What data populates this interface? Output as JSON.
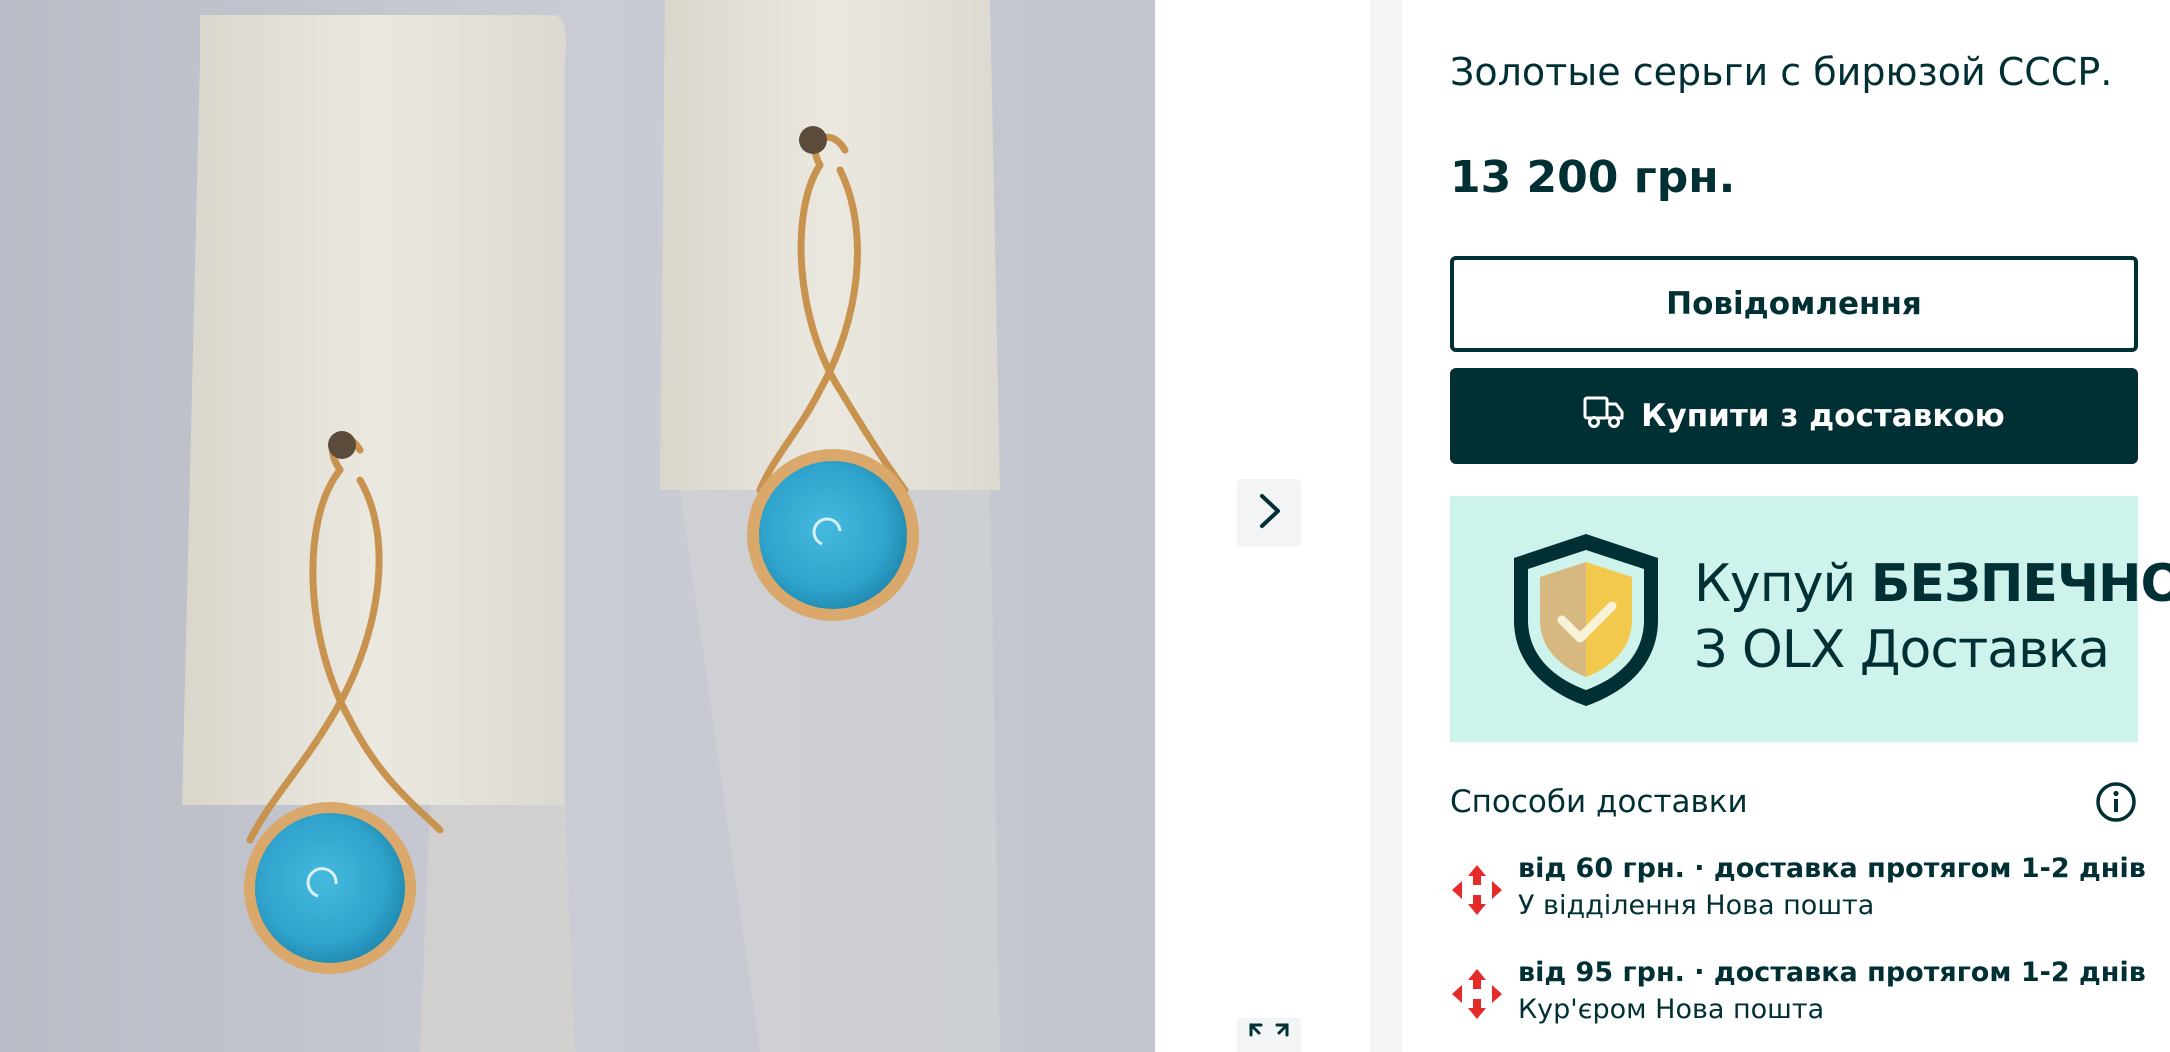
{
  "listing": {
    "title": "Золотые серьги с бирюзой СССР.",
    "price": "13 200 грн."
  },
  "gallery": {
    "next_icon": "chevron-right-icon",
    "expand_icon": "expand-icon"
  },
  "actions": {
    "message_label": "Повідомлення",
    "buy_label": "Купити з доставкою",
    "buy_icon": "truck-icon"
  },
  "promo": {
    "line1_prefix": "Купуй ",
    "line1_bold": "БЕЗПЕЧНО",
    "line2": "З OLX Доставка"
  },
  "delivery": {
    "heading": "Способи доставки",
    "info_icon": "info-icon",
    "options": [
      {
        "icon": "nova-poshta-logo",
        "summary": "від 60 грн. · доставка протягом 1-2 днів",
        "method": "У відділення Нова пошта"
      },
      {
        "icon": "nova-poshta-logo",
        "summary": "від 95 грн. · доставка протягом 1-2 днів",
        "method": "Кур'єром Нова пошта"
      }
    ]
  },
  "colors": {
    "brand_dark": "#002f34",
    "promo_bg": "#cdf3ec",
    "nova_poshta_red": "#e52a2a"
  }
}
